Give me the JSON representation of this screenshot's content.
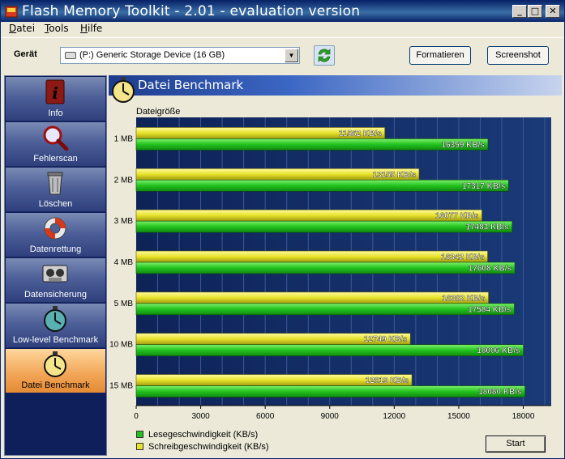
{
  "window": {
    "title": "Flash Memory Toolkit - 2.01 - evaluation version",
    "controls": {
      "minimize": "_",
      "maximize": "□",
      "close": "✕"
    }
  },
  "menu": [
    {
      "label_u": "D",
      "label_rest": "atei"
    },
    {
      "label_u": "T",
      "label_rest": "ools"
    },
    {
      "label_u": "H",
      "label_rest": "ilfe"
    }
  ],
  "toolbar": {
    "device_label": "Gerät",
    "device_value": "(P:) Generic Storage Device (16 GB)",
    "format_label": "Formatieren",
    "screenshot_label": "Screenshot"
  },
  "sidebar": {
    "items": [
      {
        "label": "Info",
        "icon": "info-icon",
        "active": false
      },
      {
        "label": "Fehlerscan",
        "icon": "magnifier-icon",
        "active": false
      },
      {
        "label": "Löschen",
        "icon": "trash-icon",
        "active": false
      },
      {
        "label": "Datenrettung",
        "icon": "lifebuoy-icon",
        "active": false
      },
      {
        "label": "Datensicherung",
        "icon": "tape-icon",
        "active": false
      },
      {
        "label": "Low-level Benchmark",
        "icon": "stopwatch-icon",
        "active": false
      },
      {
        "label": "Datei Benchmark",
        "icon": "stopwatch-gold-icon",
        "active": true
      }
    ]
  },
  "main": {
    "title": "Datei Benchmark",
    "size_caption": "Dateigröße",
    "start_label": "Start"
  },
  "colors": {
    "read": "#22c21e",
    "write": "#e6e22a",
    "plot_bg": "#12295f"
  },
  "chart_data": {
    "type": "bar",
    "orientation": "horizontal",
    "categories": [
      "1 MB",
      "2 MB",
      "3 MB",
      "4 MB",
      "5 MB",
      "10 MB",
      "15 MB"
    ],
    "series": [
      {
        "name": "Schreibgeschwindigkeit (KB/s)",
        "values": [
          11562,
          13155,
          16077,
          16342,
          16382,
          12749,
          12819
        ],
        "labels": [
          "11562 KB/s",
          "13155 KB/s",
          "16077 KB/s",
          "16342 KB/s",
          "16382 KB/s",
          "12749 KB/s",
          "12819 KB/s"
        ]
      },
      {
        "name": "Lesegeschwindigkeit (KB/s)",
        "values": [
          16359,
          17317,
          17483,
          17608,
          17584,
          18006,
          18080
        ],
        "labels": [
          "16359 KB/s",
          "17317 KB/s",
          "17483 KB/s",
          "17608 KB/s",
          "17584 KB/s",
          "18006 KB/s",
          "18080 KB/s"
        ]
      }
    ],
    "ticks": [
      0,
      3000,
      6000,
      9000,
      12000,
      15000,
      18000
    ],
    "tick_labels": [
      "0",
      "3000",
      "6000",
      "9000",
      "12000",
      "15000",
      "18000"
    ],
    "xlim": [
      0,
      19300
    ],
    "grid": true,
    "legend": [
      {
        "label": "Lesegeschwindigkeit (KB/s)",
        "series": "read"
      },
      {
        "label": "Schreibgeschwindigkeit (KB/s)",
        "series": "write"
      }
    ],
    "legend_position": "bottom-left"
  }
}
